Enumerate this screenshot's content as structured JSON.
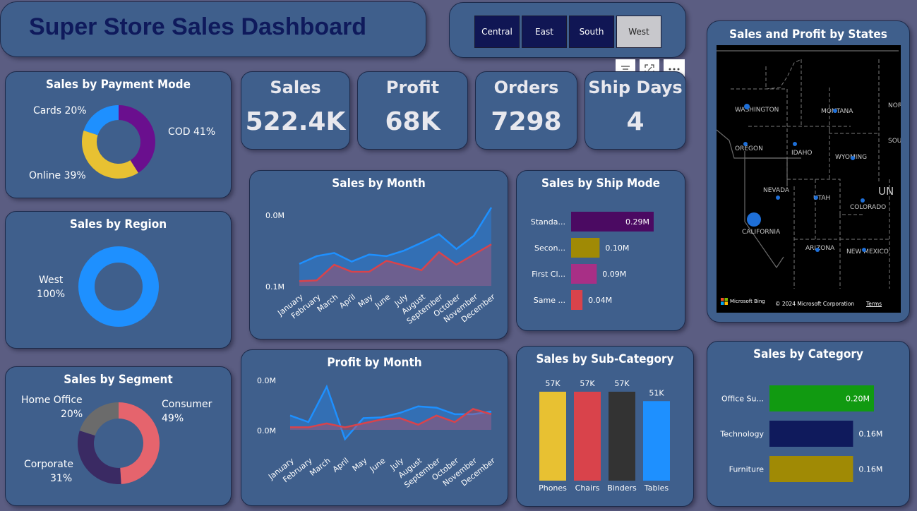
{
  "title": "Super Store Sales Dashboard",
  "slicer": {
    "options": [
      "Central",
      "East",
      "South",
      "West"
    ],
    "selected": "West"
  },
  "kpis": [
    {
      "label": "Sales",
      "value": "522.4K"
    },
    {
      "label": "Profit",
      "value": "68K"
    },
    {
      "label": "Orders",
      "value": "7298"
    },
    {
      "label": "Ship Days",
      "value": "4"
    }
  ],
  "map": {
    "title": "Sales and Profit by States",
    "states": [
      "WASHINGTON",
      "MONTANA",
      "NOR",
      "OREGON",
      "IDAHO",
      "WYOMING",
      "SOU",
      "NEVADA",
      "UTAH",
      "COLORADO",
      "UN",
      "CALIFORNIA",
      "ARIZONA",
      "NEW MEXICO"
    ],
    "attribution": {
      "brand": "Microsoft Bing",
      "copyright": "© 2024 Microsoft Corporation",
      "terms": "Terms"
    }
  },
  "colors": {
    "background": "#5b5d82",
    "card": "#3f5f8c",
    "title": "#0f1a5c",
    "accent": "#1e90ff"
  },
  "chart_data": [
    {
      "id": "payment_mode",
      "type": "pie",
      "title": "Sales by Payment Mode",
      "categories": [
        "COD",
        "Online",
        "Cards"
      ],
      "values": [
        41,
        39,
        20
      ],
      "labels": [
        "COD 41%",
        "Online 39%",
        "Cards 20%"
      ],
      "colors": [
        "#6a0f8e",
        "#e8c132",
        "#1e90ff"
      ]
    },
    {
      "id": "region",
      "type": "pie",
      "title": "Sales by Region",
      "categories": [
        "West"
      ],
      "values": [
        100
      ],
      "labels": [
        "West",
        "100%"
      ],
      "colors": [
        "#1e90ff"
      ]
    },
    {
      "id": "segment",
      "type": "pie",
      "title": "Sales by Segment",
      "categories": [
        "Consumer",
        "Corporate",
        "Home Office"
      ],
      "values": [
        49,
        31,
        20
      ],
      "labels": [
        [
          "Consumer",
          "49%"
        ],
        [
          "Corporate",
          "31%"
        ],
        [
          "Home Office",
          "20%"
        ]
      ],
      "colors": [
        "#e5646d",
        "#3a2a63",
        "#6b6b6b"
      ]
    },
    {
      "id": "sales_month",
      "type": "area",
      "title": "Sales by Month",
      "categories": [
        "January",
        "February",
        "March",
        "April",
        "May",
        "June",
        "July",
        "August",
        "September",
        "October",
        "November",
        "December"
      ],
      "ylim": [
        0,
        0.1
      ],
      "yticks": [
        "0.0M",
        "0.1M"
      ],
      "series": [
        {
          "values": [
            0.028,
            0.038,
            0.042,
            0.031,
            0.04,
            0.038,
            0.045,
            0.055,
            0.066,
            0.047,
            0.064,
            0.1
          ],
          "color": "#1e90ff"
        },
        {
          "values": [
            0.006,
            0.007,
            0.027,
            0.018,
            0.018,
            0.032,
            0.026,
            0.02,
            0.043,
            0.027,
            0.04,
            0.053
          ],
          "color": "#d9434b"
        }
      ]
    },
    {
      "id": "ship_mode",
      "type": "bar",
      "title": "Sales by Ship Mode",
      "categories": [
        "Standa...",
        "Secon...",
        "First Cl...",
        "Same ..."
      ],
      "values": [
        0.29,
        0.1,
        0.09,
        0.04
      ],
      "value_labels": [
        "0.29M",
        "0.10M",
        "0.09M",
        "0.04M"
      ],
      "colors": [
        "#4b0a62",
        "#a08a05",
        "#a82f86",
        "#d9434b"
      ]
    },
    {
      "id": "profit_month",
      "type": "area",
      "title": "Profit by Month",
      "categories": [
        "January",
        "February",
        "March",
        "April",
        "May",
        "June",
        "July",
        "August",
        "September",
        "October",
        "November",
        "December"
      ],
      "yticks": [
        "0.0M",
        "0.0M"
      ],
      "series": [
        {
          "values": [
            5.5,
            3.0,
            16.5,
            -3.5,
            4.5,
            4.8,
            6.5,
            9.0,
            8.5,
            6.0,
            6.0,
            7.0
          ],
          "color": "#1e90ff"
        },
        {
          "values": [
            1.0,
            1.0,
            2.5,
            1.0,
            2.5,
            4.0,
            4.5,
            2.0,
            5.5,
            3.0,
            8.0,
            6.0
          ],
          "color": "#d9434b"
        }
      ]
    },
    {
      "id": "sub_category",
      "type": "bar",
      "title": "Sales by Sub-Category",
      "categories": [
        "Phones",
        "Chairs",
        "Binders",
        "Tables"
      ],
      "values": [
        57,
        57,
        57,
        51
      ],
      "value_labels": [
        "57K",
        "57K",
        "57K",
        "51K"
      ],
      "colors": [
        "#e8c132",
        "#d9434b",
        "#333333",
        "#1e90ff"
      ]
    },
    {
      "id": "category",
      "type": "bar",
      "title": "Sales by Category",
      "categories": [
        "Office Su...",
        "Technology",
        "Furniture"
      ],
      "values": [
        0.2,
        0.16,
        0.16
      ],
      "value_labels": [
        "0.20M",
        "0.16M",
        "0.16M"
      ],
      "colors": [
        "#119a11",
        "#0f1a5c",
        "#a08a05"
      ]
    }
  ]
}
